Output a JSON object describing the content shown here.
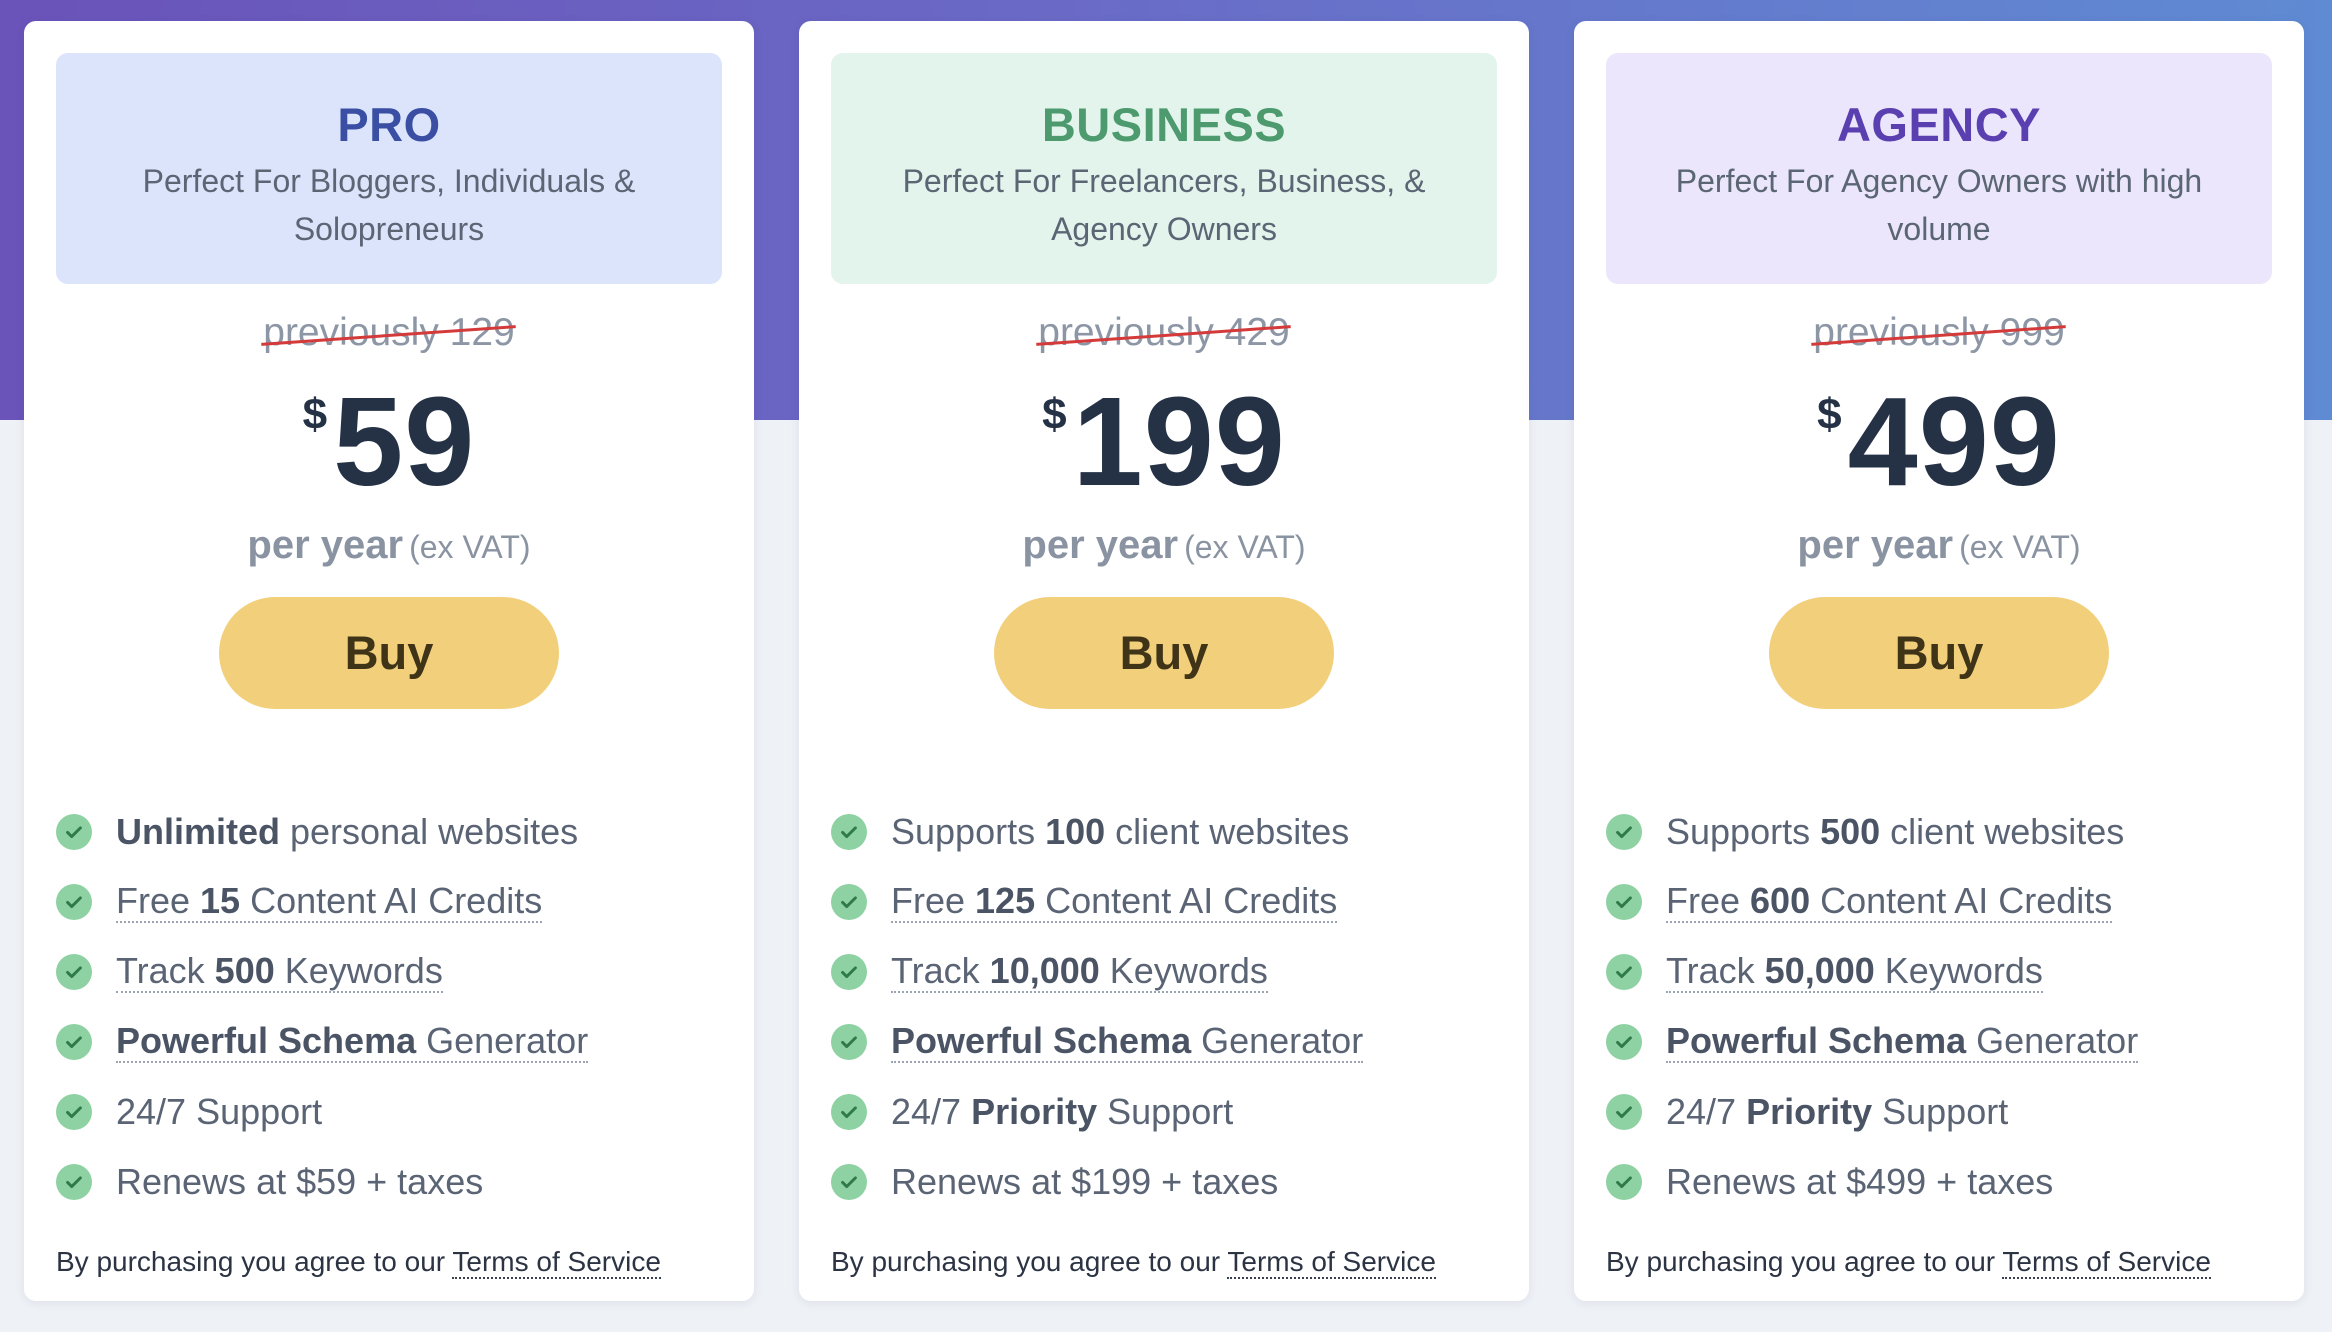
{
  "plans": [
    {
      "name": "PRO",
      "name_color": "#3a4fa3",
      "head_bg": "#dce4fb",
      "description": "Perfect For Bloggers, Individuals & Solopreneurs",
      "previous": "previously 129",
      "currency": "$",
      "price": "59",
      "per": "per year",
      "vat": "(ex VAT)",
      "buy_label": "Buy",
      "features": [
        {
          "pre": "",
          "bold": "Unlimited",
          "post": " personal websites"
        },
        {
          "pre": "Free ",
          "bold": "15",
          "post": " Content AI Credits"
        },
        {
          "pre": "Track ",
          "bold": "500",
          "post": " Keywords"
        },
        {
          "pre": "",
          "bold": "Powerful Schema",
          "post": " Generator"
        },
        {
          "pre": "24/7 Support",
          "bold": "",
          "post": ""
        },
        {
          "pre": "Renews at $59 + taxes",
          "bold": "",
          "post": ""
        }
      ],
      "tos_text": "By purchasing you agree to our ",
      "tos_link": "Terms of Service"
    },
    {
      "name": "BUSINESS",
      "name_color": "#4c9a6e",
      "head_bg": "#e2f4ec",
      "description": "Perfect For Freelancers, Business, & Agency Owners",
      "previous": "previously 429",
      "currency": "$",
      "price": "199",
      "per": "per year",
      "vat": "(ex VAT)",
      "buy_label": "Buy",
      "features": [
        {
          "pre": "Supports ",
          "bold": "100",
          "post": " client websites"
        },
        {
          "pre": "Free ",
          "bold": "125",
          "post": " Content AI Credits"
        },
        {
          "pre": "Track ",
          "bold": "10,000",
          "post": " Keywords"
        },
        {
          "pre": "",
          "bold": "Powerful Schema",
          "post": " Generator"
        },
        {
          "pre": "24/7 ",
          "bold": "Priority",
          "post": " Support"
        },
        {
          "pre": "Renews at $199 + taxes",
          "bold": "",
          "post": ""
        }
      ],
      "tos_text": "By purchasing you agree to our ",
      "tos_link": "Terms of Service"
    },
    {
      "name": "AGENCY",
      "name_color": "#5a3fb0",
      "head_bg": "#ebe6fb",
      "description": "Perfect For Agency Owners with high volume",
      "previous": "previously 999",
      "currency": "$",
      "price": "499",
      "per": "per year",
      "vat": "(ex VAT)",
      "buy_label": "Buy",
      "features": [
        {
          "pre": "Supports ",
          "bold": "500",
          "post": " client websites"
        },
        {
          "pre": "Free ",
          "bold": "600",
          "post": " Content AI Credits"
        },
        {
          "pre": "Track ",
          "bold": "50,000",
          "post": " Keywords"
        },
        {
          "pre": "",
          "bold": "Powerful Schema",
          "post": " Generator"
        },
        {
          "pre": "24/7 ",
          "bold": "Priority",
          "post": " Support"
        },
        {
          "pre": "Renews at $499 + taxes",
          "bold": "",
          "post": ""
        }
      ],
      "tos_text": "By purchasing you agree to our ",
      "tos_link": "Terms of Service"
    }
  ],
  "feature_icon": "check-circle-icon",
  "colors": {
    "buy_button": "#f2cf7b",
    "check": "#8ed1a2",
    "strike": "#d43a3a",
    "price": "#253246"
  }
}
